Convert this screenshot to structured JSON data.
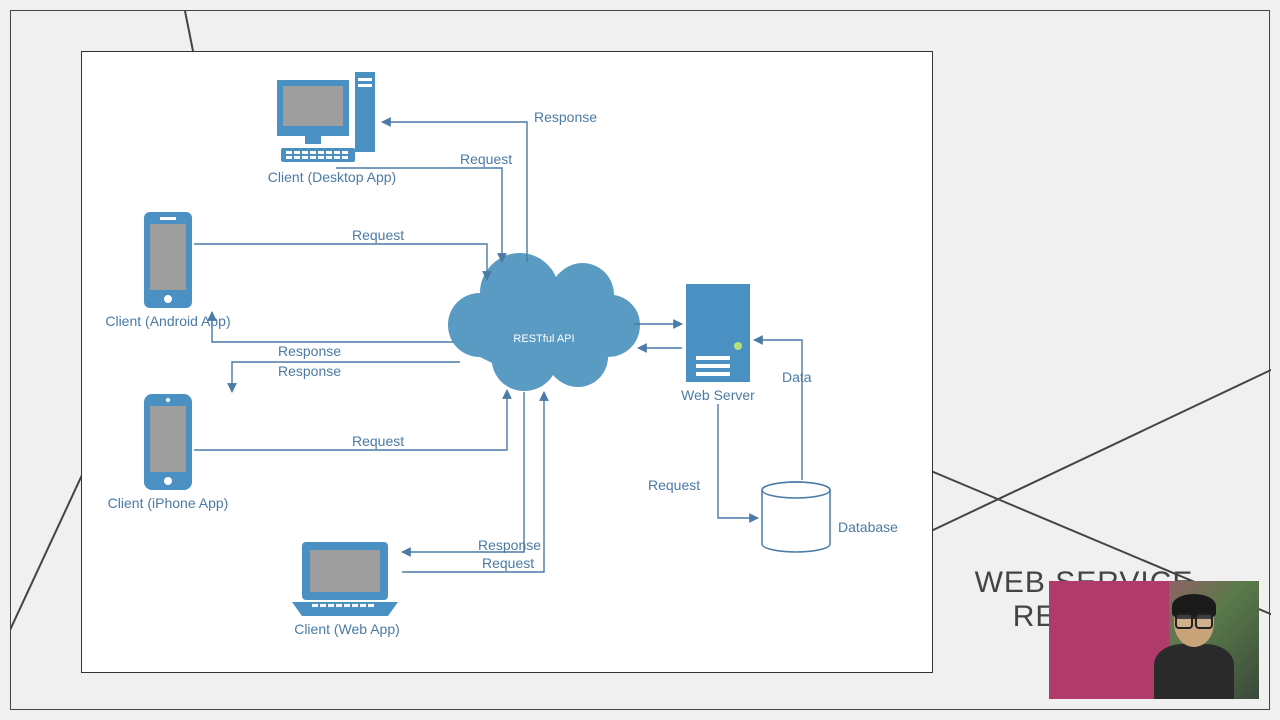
{
  "title_line1": "WEB SERVICE",
  "title_line2": "REST API",
  "diagram": {
    "center_label": "RESTful API",
    "nodes": {
      "desktop": "Client (Desktop App)",
      "android": "Client (Android App)",
      "iphone": "Client (iPhone App)",
      "webapp": "Client (Web App)",
      "server": "Web Server",
      "database": "Database"
    },
    "edge_labels": {
      "request": "Request",
      "response": "Response",
      "data": "Data"
    },
    "edges": [
      {
        "from": "desktop",
        "to": "restful_api",
        "label": "Request"
      },
      {
        "from": "restful_api",
        "to": "desktop",
        "label": "Response"
      },
      {
        "from": "android",
        "to": "restful_api",
        "label": "Request"
      },
      {
        "from": "restful_api",
        "to": "android",
        "label": "Response"
      },
      {
        "from": "iphone",
        "to": "restful_api",
        "label": "Request"
      },
      {
        "from": "restful_api",
        "to": "iphone",
        "label": "Response"
      },
      {
        "from": "webapp",
        "to": "restful_api",
        "label": "Request"
      },
      {
        "from": "restful_api",
        "to": "webapp",
        "label": "Response"
      },
      {
        "from": "restful_api",
        "to": "server",
        "label": ""
      },
      {
        "from": "server",
        "to": "restful_api",
        "label": ""
      },
      {
        "from": "server",
        "to": "database",
        "label": "Request"
      },
      {
        "from": "database",
        "to": "server",
        "label": "Data"
      }
    ]
  }
}
